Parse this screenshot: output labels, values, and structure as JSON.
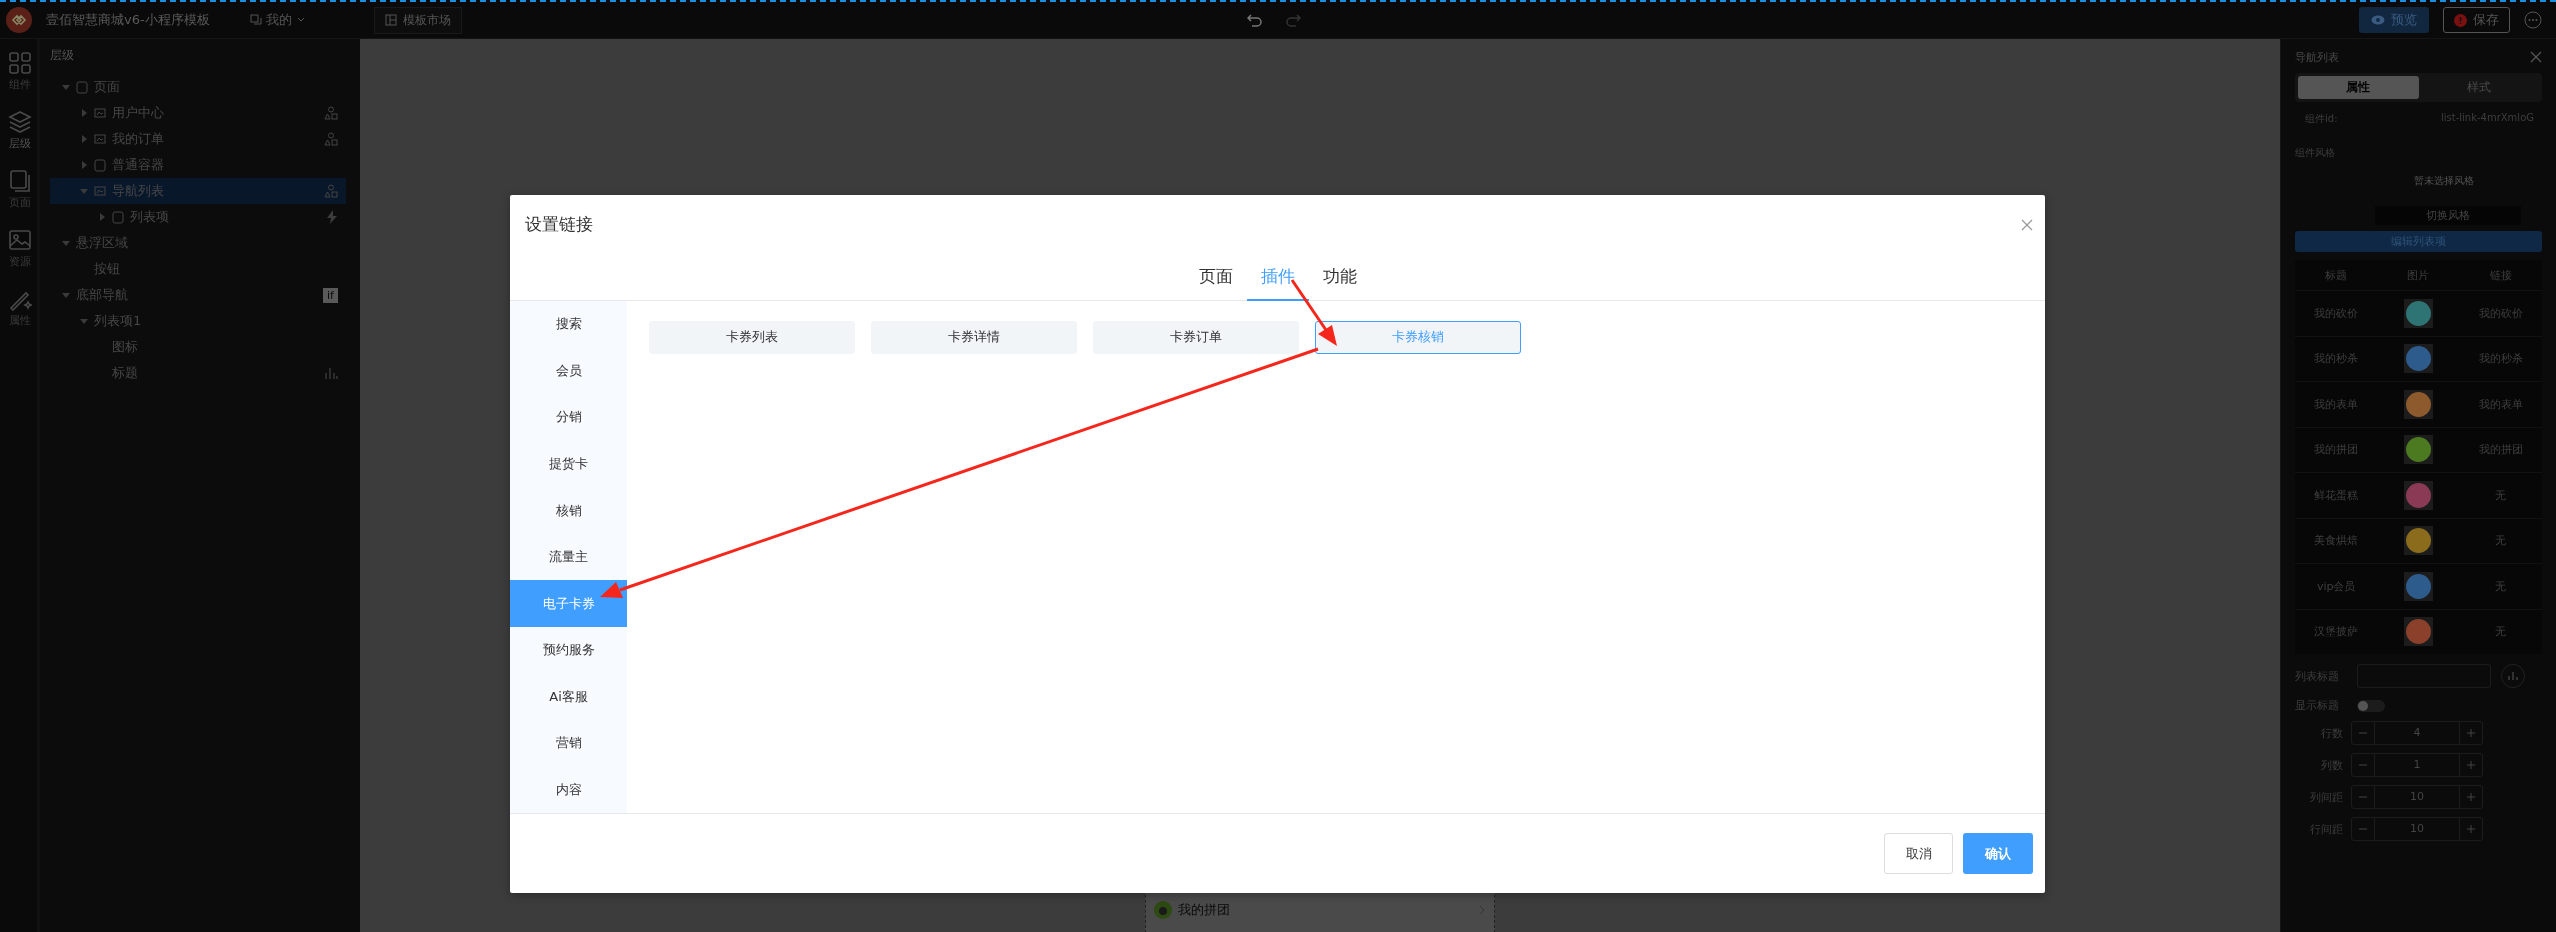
{
  "app": {
    "title": "壹佰智慧商城v6-小程序模板",
    "workspace": "我的",
    "market": "模板市场",
    "preview": "预览",
    "save": "保存"
  },
  "rail": [
    {
      "label": "组件",
      "selected": false
    },
    {
      "label": "层级",
      "selected": true
    },
    {
      "label": "页面",
      "selected": false
    },
    {
      "label": "资源",
      "selected": false
    },
    {
      "label": "属性",
      "selected": false
    }
  ],
  "layers": {
    "title": "层级",
    "tree": [
      {
        "label": "页面",
        "kind": "container",
        "expanded": true,
        "selected": false,
        "children": [
          {
            "label": "用户中心",
            "kind": "image",
            "expanded": false,
            "selected": false,
            "marker": {
              "kind": "shapes"
            }
          },
          {
            "label": "我的订单",
            "kind": "image",
            "expanded": false,
            "selected": false,
            "marker": {
              "kind": "shapes"
            }
          },
          {
            "label": "普通容器",
            "kind": "container",
            "expanded": false,
            "selected": false
          },
          {
            "label": "导航列表",
            "kind": "image",
            "expanded": true,
            "selected": true,
            "marker": {
              "kind": "shapes"
            },
            "children": [
              {
                "label": "列表项",
                "kind": "container",
                "expanded": false,
                "selected": false,
                "marker": {
                  "kind": "bolt"
                }
              }
            ]
          }
        ]
      },
      {
        "label": "悬浮区域",
        "kind": "plain",
        "expanded": true,
        "selected": false,
        "children": [
          {
            "label": "按钮",
            "kind": "plain",
            "selected": false
          }
        ]
      },
      {
        "label": "底部导航",
        "kind": "plain",
        "expanded": true,
        "selected": false,
        "badge": "if",
        "children": [
          {
            "label": "列表项1",
            "kind": "plain",
            "expanded": true,
            "selected": false,
            "children": [
              {
                "label": "图标",
                "kind": "plain",
                "selected": false
              },
              {
                "label": "标题",
                "kind": "plain",
                "selected": false,
                "marker": {
                  "kind": "bars"
                }
              }
            ]
          }
        ]
      }
    ]
  },
  "canvas": {
    "item": "我的拼团"
  },
  "props": {
    "title": "导航列表",
    "tabs": [
      {
        "label": "属性",
        "selected": true
      },
      {
        "label": "样式",
        "selected": false
      }
    ],
    "id_label": "组件id:",
    "id_value": "list-link-4mrXmloG",
    "style_label": "组件风格",
    "style_empty": "暂未选择风格",
    "switch_style": "切换风格",
    "edit_items": "编辑列表项",
    "table": {
      "columns": [
        "标题",
        "图片",
        "链接"
      ],
      "rows": [
        {
          "title": "我的砍价",
          "color": "#2f7474",
          "link": "我的砍价"
        },
        {
          "title": "我的秒杀",
          "color": "#2d5b8c",
          "link": "我的秒杀"
        },
        {
          "title": "我的表单",
          "color": "#8c5a2c",
          "link": "我的表单"
        },
        {
          "title": "我的拼团",
          "color": "#4c7a20",
          "link": "我的拼团"
        },
        {
          "title": "鲜花蛋糕",
          "color": "#8a3a55",
          "link": "无"
        },
        {
          "title": "美食烘焙",
          "color": "#8a6c1c",
          "link": "无"
        },
        {
          "title": "vip会员",
          "color": "#2d5b8c",
          "link": "无"
        },
        {
          "title": "汉堡披萨",
          "color": "#8a402a",
          "link": "无"
        }
      ]
    },
    "list_title_label": "列表标题",
    "show_title": {
      "label": "显示标题",
      "on": false
    },
    "steppers": [
      {
        "label": "行数",
        "value": "4"
      },
      {
        "label": "列数",
        "value": "1"
      },
      {
        "label": "列间距",
        "value": "10"
      },
      {
        "label": "行间距",
        "value": "10"
      }
    ]
  },
  "dialog": {
    "title": "设置链接",
    "tabs": [
      {
        "label": "页面",
        "selected": false
      },
      {
        "label": "插件",
        "selected": true
      },
      {
        "label": "功能",
        "selected": false
      }
    ],
    "categories": [
      {
        "label": "搜索",
        "selected": false
      },
      {
        "label": "会员",
        "selected": false
      },
      {
        "label": "分销",
        "selected": false
      },
      {
        "label": "提货卡",
        "selected": false
      },
      {
        "label": "核销",
        "selected": false
      },
      {
        "label": "流量主",
        "selected": false
      },
      {
        "label": "电子卡券",
        "selected": true
      },
      {
        "label": "预约服务",
        "selected": false
      },
      {
        "label": "Ai客服",
        "selected": false
      },
      {
        "label": "营销",
        "selected": false
      },
      {
        "label": "内容",
        "selected": false
      }
    ],
    "links": [
      {
        "label": "卡券列表",
        "selected": false
      },
      {
        "label": "卡券详情",
        "selected": false
      },
      {
        "label": "卡券订单",
        "selected": false
      },
      {
        "label": "卡券核销",
        "selected": true
      }
    ],
    "cancel": "取消",
    "confirm": "确认"
  }
}
